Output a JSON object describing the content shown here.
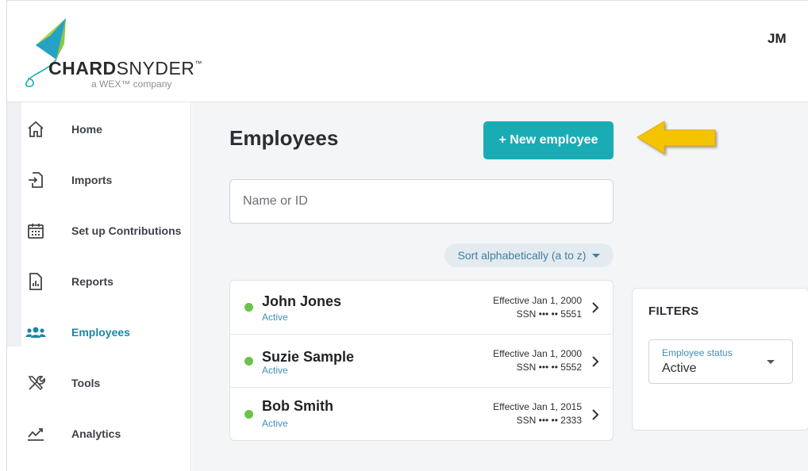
{
  "header": {
    "logo_name_bold": "CHARD",
    "logo_name_light": "SNYDER",
    "logo_tm": "™",
    "logo_tagline": "a WEX™ company",
    "user_initials": "JM"
  },
  "sidebar": {
    "items": [
      {
        "label": "Home",
        "icon": "home-icon"
      },
      {
        "label": "Imports",
        "icon": "import-icon"
      },
      {
        "label": "Set up Contributions",
        "icon": "calendar-icon"
      },
      {
        "label": "Reports",
        "icon": "report-icon"
      },
      {
        "label": "Employees",
        "icon": "people-icon",
        "active": true
      },
      {
        "label": "Tools",
        "icon": "tools-icon"
      },
      {
        "label": "Analytics",
        "icon": "analytics-icon"
      }
    ]
  },
  "main": {
    "title": "Employees",
    "new_button": "+ New employee",
    "search_placeholder": "Name or ID",
    "sort_label": "Sort alphabetically (a to z)",
    "employees": [
      {
        "name": "John Jones",
        "status": "Active",
        "effective": "Effective Jan 1, 2000",
        "ssn": "SSN ••• •• 5551"
      },
      {
        "name": "Suzie Sample",
        "status": "Active",
        "effective": "Effective Jan 1, 2000",
        "ssn": "SSN ••• •• 5552"
      },
      {
        "name": "Bob Smith",
        "status": "Active",
        "effective": "Effective Jan 1, 2015",
        "ssn": "SSN ••• •• 2333"
      }
    ]
  },
  "filters": {
    "title": "FILTERS",
    "status_label": "Employee status",
    "status_value": "Active"
  },
  "colors": {
    "accent": "#1aacb5",
    "active_nav": "#1a86a8",
    "status_dot": "#6cc24a",
    "arrow": "#f5c400"
  }
}
